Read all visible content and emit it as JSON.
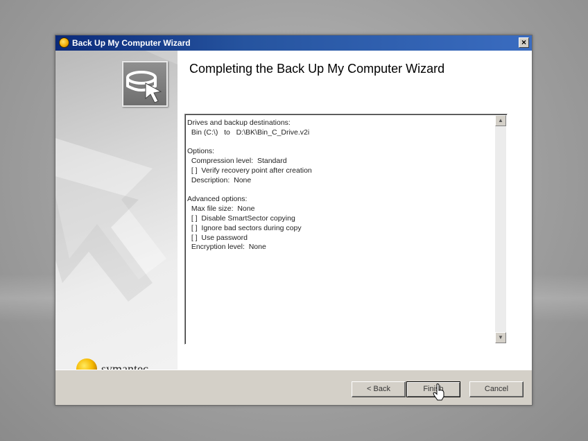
{
  "window": {
    "title": "Back Up My Computer Wizard",
    "close_glyph": "×"
  },
  "branding": {
    "logo_text": "symantec."
  },
  "heading": "Completing the Back Up My Computer Wizard",
  "summary_lines": [
    "Drives and backup destinations:",
    "  Bin (C:\\)   to   D:\\BK\\Bin_C_Drive.v2i",
    "",
    "Options:",
    "  Compression level:  Standard",
    "  [ ]  Verify recovery point after creation",
    "  Description:  None",
    "",
    "Advanced options:",
    "  Max file size:  None",
    "  [ ]  Disable SmartSector copying",
    "  [ ]  Ignore bad sectors during copy",
    "  [ ]  Use password",
    "  Encryption level:  None"
  ],
  "scrollbar": {
    "up_glyph": "▲",
    "down_glyph": "▼"
  },
  "buttons": {
    "back": "< Back",
    "finish": "Finish",
    "cancel": "Cancel"
  },
  "icons": {
    "title": "wizard-app-icon",
    "header": "drive-backup-icon",
    "brand": "symantec-logo-icon",
    "cursor": "mouse-pointer-icon"
  }
}
